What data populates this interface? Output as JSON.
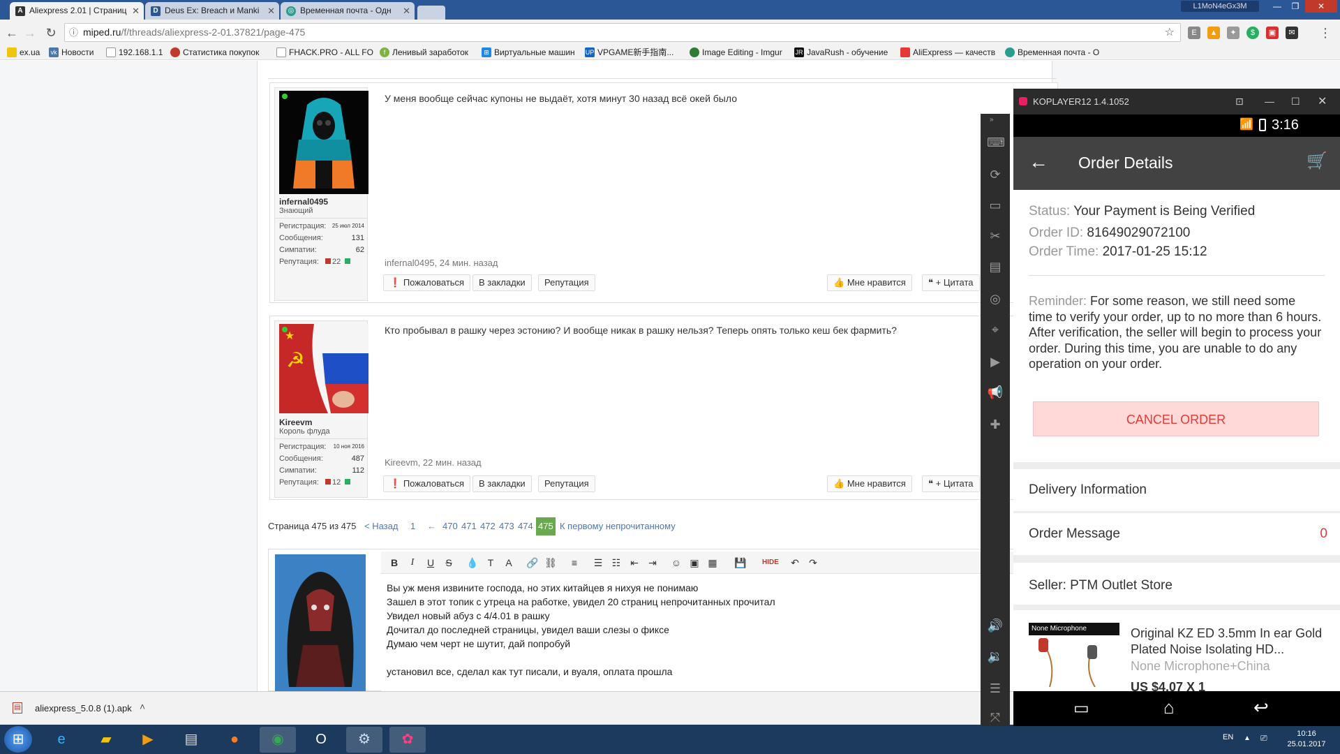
{
  "browser": {
    "tabs": [
      {
        "label": "Aliexpress 2.01 | Страниц",
        "active": true
      },
      {
        "label": "Deus Ex: Breach и Manki",
        "active": false
      },
      {
        "label": "Временная почта - Одн",
        "active": false
      }
    ],
    "user_badge": "L1MoN4eGx3M",
    "url_host": "miped.ru",
    "url_path": "/f/threads/aliexpress-2-01.37821/page-475",
    "bookmarks": [
      "ex.ua",
      "Новости",
      "192.168.1.1",
      "Статистика покупок",
      "FHACK.PRO - ALL FO",
      "Ленивый заработок",
      "Виртуальные машин",
      "VPGAME新手指南...",
      "Image Editing - Imgur",
      "JavaRush - обучение",
      "AliExpress — качеств",
      "Временная почта - О"
    ]
  },
  "forum": {
    "posts": [
      {
        "username": "infernal0495",
        "user_title": "Знающий",
        "stats": [
          {
            "label": "Регистрация:",
            "value": "25 июл 2014"
          },
          {
            "label": "Сообщения:",
            "value": "131"
          },
          {
            "label": "Симпатии:",
            "value": "62"
          },
          {
            "label": "Репутация:",
            "value": "22"
          }
        ],
        "message": "У меня вообще сейчас купоны не выдаёт, хотя минут 30 назад всё окей было",
        "meta": "infernal0495, 24 мин. назад"
      },
      {
        "username": "Kireevm",
        "user_title": "Король флуда",
        "stats": [
          {
            "label": "Регистрация:",
            "value": "10 ноя 2016"
          },
          {
            "label": "Сообщения:",
            "value": "487"
          },
          {
            "label": "Симпатии:",
            "value": "112"
          },
          {
            "label": "Репутация:",
            "value": "12"
          }
        ],
        "message": "Кто пробывал в рашку через эстонию? И вообще никак в рашку нельзя? Теперь опять только кеш бек фармить?",
        "meta": "Kireevm, 22 мин. назад"
      }
    ],
    "actions": {
      "report": "Пожаловаться",
      "bookmark": "В закладки",
      "reputation": "Репутация",
      "like": "Мне нравится",
      "quote": "+ Цитата"
    },
    "pagination": {
      "label": "Страница 475 из 475",
      "prev": "< Назад",
      "first": "1",
      "ellipsis": "←",
      "pages": [
        "470",
        "471",
        "472",
        "473",
        "474"
      ],
      "current": "475",
      "unread": "К первому непрочитанному"
    },
    "editor": {
      "lines": [
        "Вы уж меня извините господа, но этих китайцев я нихуя не понимаю",
        "Зашел в этот топик с утреца на работке, увидел 20 страниц непрочитанных прочитал",
        "Увидел новый абуз с 4/4.01 в рашку",
        "Дочитал до последней страницы, увидел ваши слезы о фиксе",
        "Думаю чем черт не шутит, дай попробуй",
        "",
        "установил все, сделал как тут писали, и вуаля, оплата прошла"
      ]
    }
  },
  "downloads": {
    "file": "aliexpress_5.0.8 (1).apk"
  },
  "taskbar": {
    "lang": "EN",
    "time": "10:16",
    "date": "25.01.2017"
  },
  "emulator": {
    "title": "KOPLAYER12 1.4.1052",
    "clock": "3:16",
    "app": {
      "header": "Order Details",
      "status_label": "Status:",
      "status_value": "Your Payment is Being Verified",
      "order_id_label": "Order ID:",
      "order_id_value": "81649029072100",
      "order_time_label": "Order Time:",
      "order_time_value": "2017-01-25 15:12",
      "reminder_label": "Reminder:",
      "reminder_text": "For some reason, we still need some time to verify your order, up to no more than 6 hours. After verification, the seller will begin to process your order. During this time, you are unable to do any operation on your order.",
      "cancel_label": "CANCEL ORDER",
      "delivery_label": "Delivery Information",
      "message_label": "Order Message",
      "message_count": "0",
      "seller_label": "Seller: PTM Outlet Store",
      "product_badge": "None Microphone",
      "product_title": "Original KZ ED 3.5mm In ear Gold Plated Noise Isolating HD...",
      "product_variant": "None Microphone+China",
      "product_price": "US $4.07 X 1"
    }
  }
}
